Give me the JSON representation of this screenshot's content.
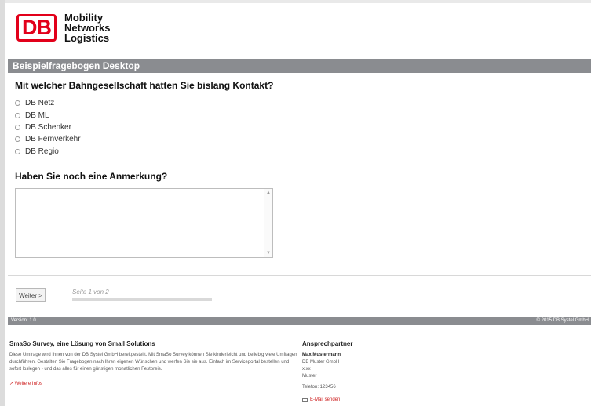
{
  "brand": {
    "logo_text": "DB",
    "name_lines": [
      "Mobility",
      "Networks",
      "Logistics"
    ]
  },
  "survey": {
    "title": "Beispielfragebogen Desktop",
    "question1": "Mit welcher Bahngesellschaft hatten Sie bislang Kontakt?",
    "options": [
      "DB Netz",
      "DB ML",
      "DB Schenker",
      "DB Fernverkehr",
      "DB Regio"
    ],
    "question2": "Haben Sie noch eine Anmerkung?",
    "remark_value": ""
  },
  "navigation": {
    "next_label": "Weiter >",
    "page_label": "Seite 1 von 2",
    "progress_fraction": 0
  },
  "footer_bar": {
    "version": "Version: 1.0",
    "copyright": "© 2015 DB Systel GmbH"
  },
  "footer": {
    "title": "SmaSo Survey, eine Lösung von Small Solutions",
    "text": "Diese Umfrage wird Ihnen von der DB Systel GmbH bereitgestellt. Mit SmaSo Survey können Sie kinderleicht und beliebig viele Umfragen durchführen. Gestalten Sie Fragebogen nach Ihren eigenen Wünschen und werfen Sie sie aus. Einfach im Serviceportal bestellen und sofort loslegen - und das alles für einen günstigen monatlichen Festpreis.",
    "more_info": "↗ Weitere Infos"
  },
  "contact": {
    "title": "Ansprechpartner",
    "name": "Max Mustermann",
    "company": "DB Muster GmbH",
    "line3": "x.xx",
    "line4": "Muster",
    "phone": "Telefon: 123456",
    "email": "E-Mail senden"
  },
  "icons": {
    "mail": "mail-icon"
  },
  "colors": {
    "brand_red": "#e2001a",
    "bar_gray": "#8a8c90"
  }
}
